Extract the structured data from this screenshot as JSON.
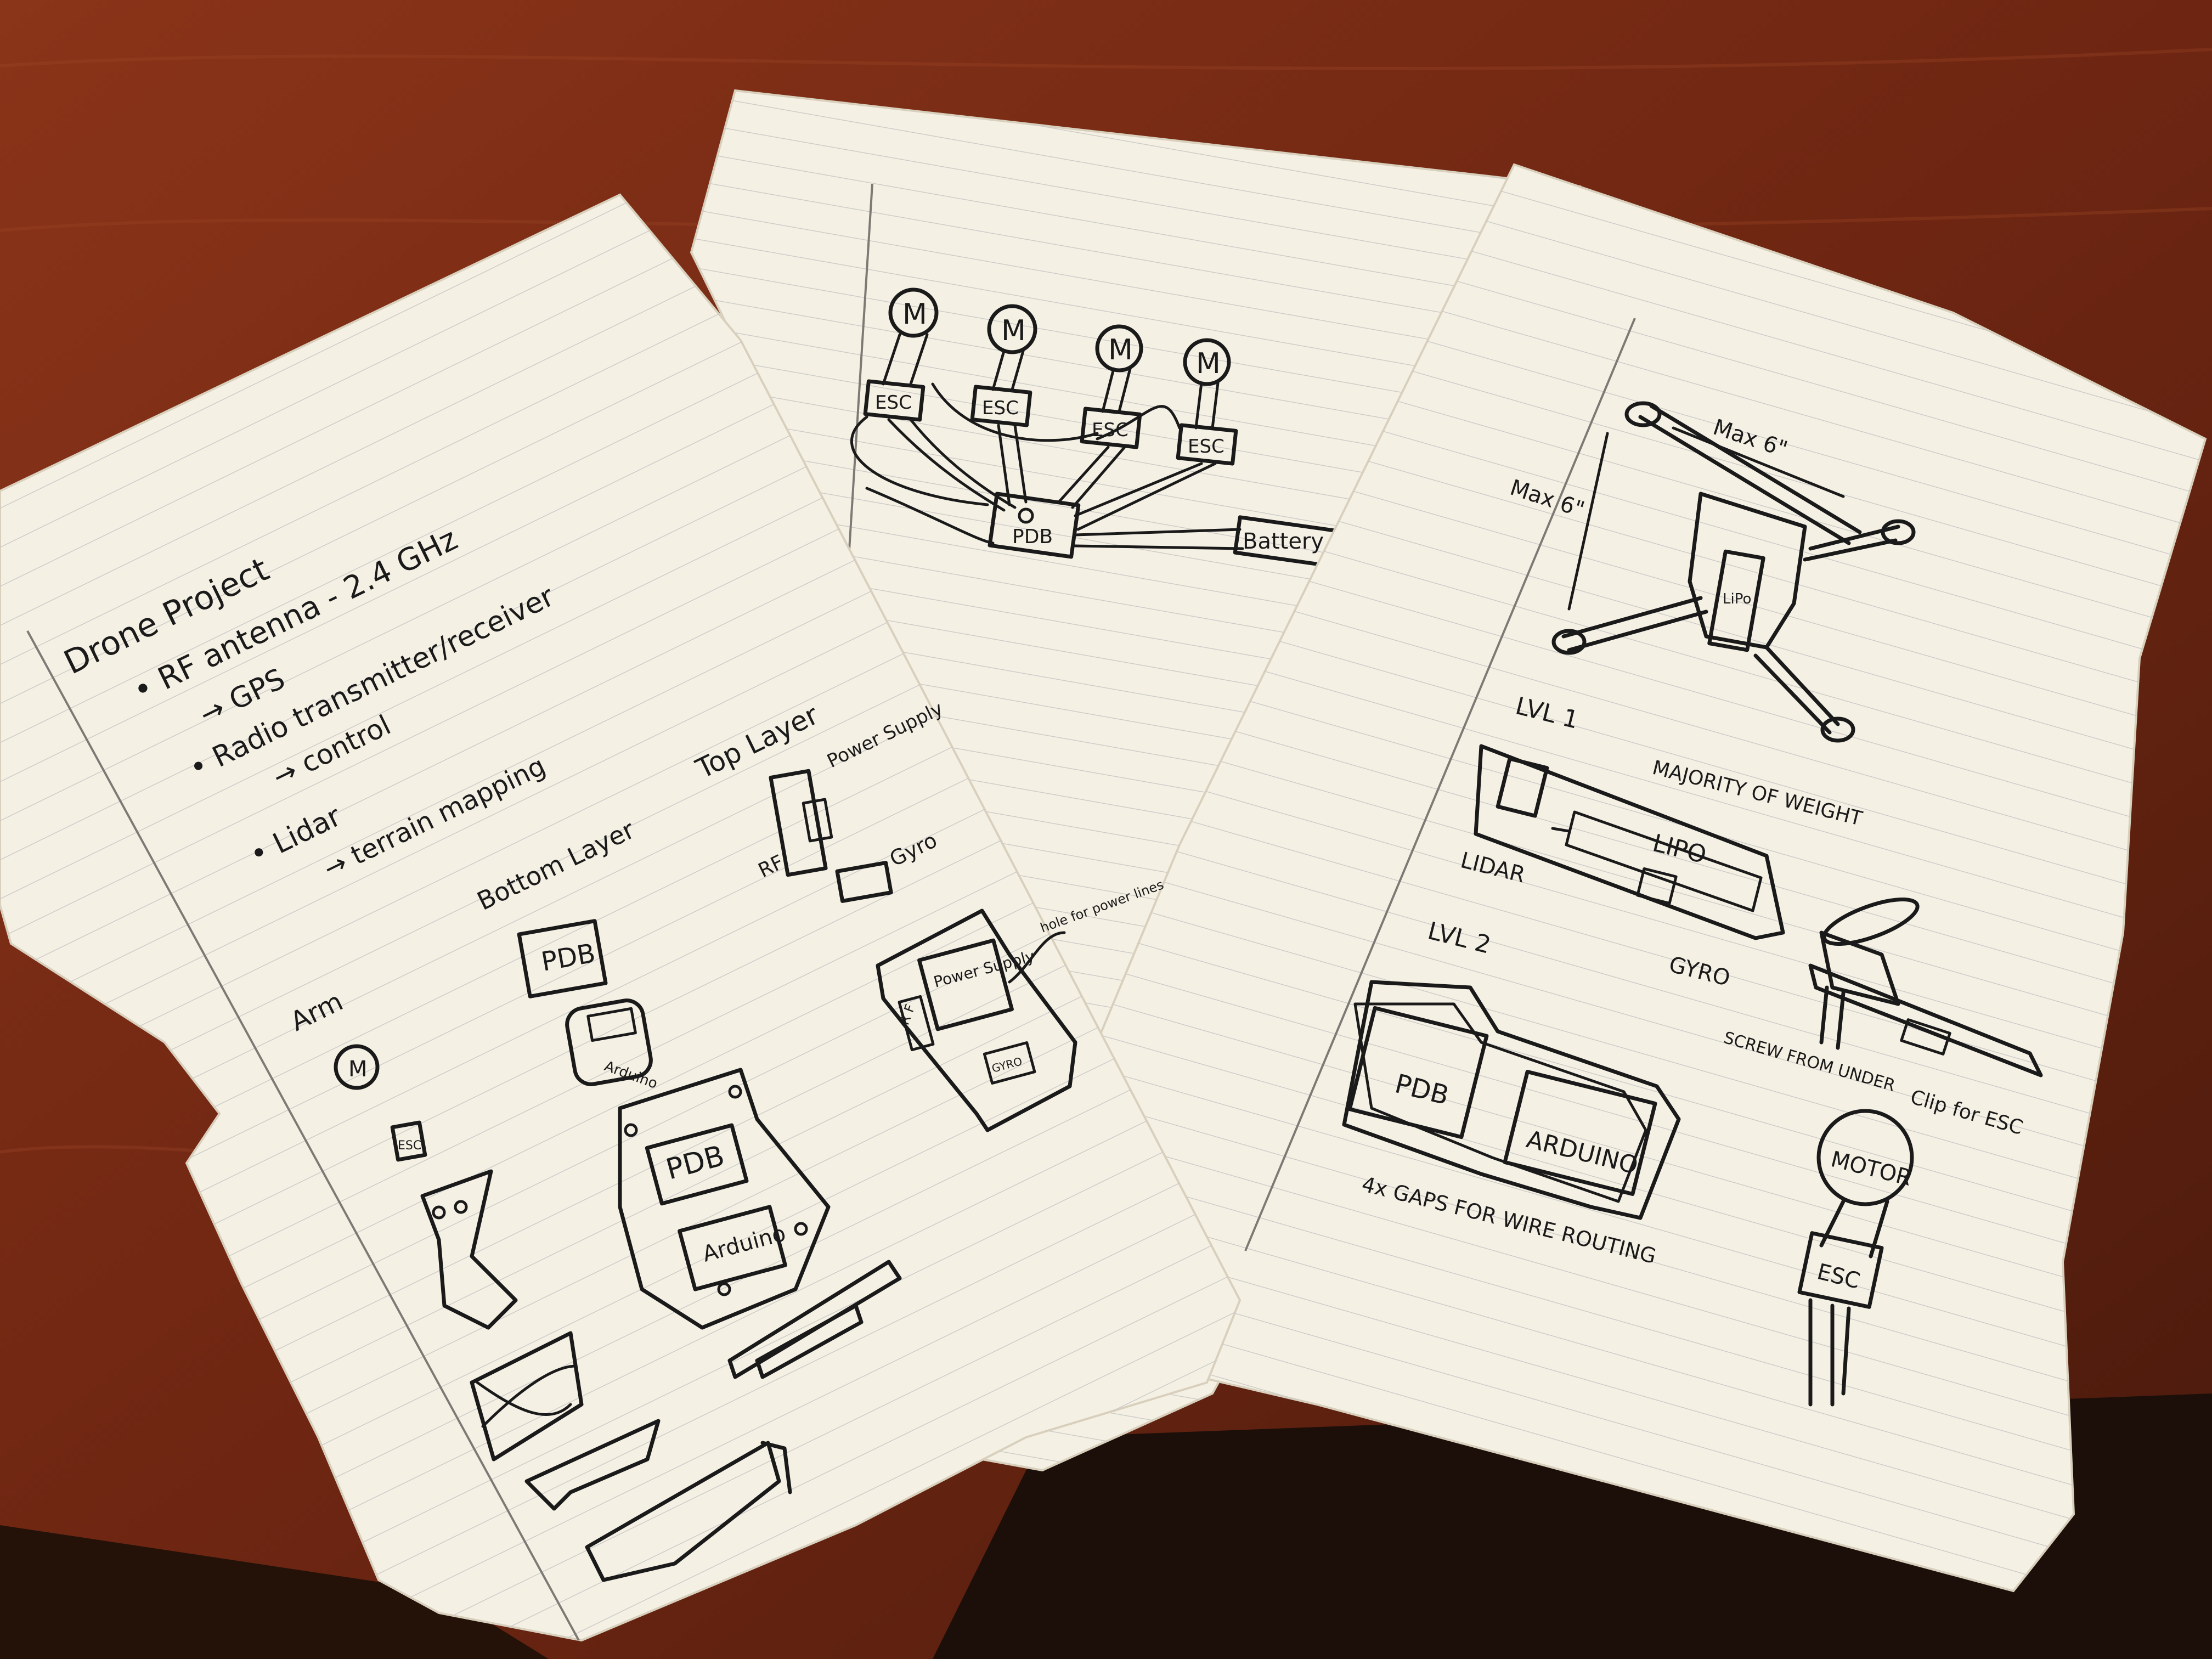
{
  "scene": {
    "colors": {
      "desk_wood": "#7a2c14",
      "desk_wood_light": "#9a4424",
      "desk_dark": "#1c0f0a",
      "paper": "#f5f0e4",
      "paper_shadow": "#d8d0bd",
      "rule_line": "#c9c8c6",
      "margin_line": "#7d7a76",
      "ink": "#1a1a1a"
    }
  },
  "left_sheet": {
    "title": "Drone Project",
    "notes": [
      "• RF antenna - 2.4 GHz",
      "→ GPS",
      "• Radio transmitter/receiver",
      "→ control",
      "• Lidar",
      "→ terrain mapping"
    ],
    "labels": {
      "top_layer": "Top Layer",
      "power_supply": "Power Supply",
      "rf": "RF",
      "gyro": "Gyro",
      "bottom_layer": "Bottom Layer",
      "pdb": "PDB",
      "arduino": "Arduino",
      "arm": "Arm",
      "motor": "M",
      "esc": "ESC",
      "hole_for_power_lines": "hole for power lines",
      "pdb_big": "PDB",
      "arduino_big": "Arduino",
      "power_supply_small": "Power Supply",
      "rf_small": "R F",
      "gyro_small": "GYRO"
    }
  },
  "middle_sheet": {
    "motor_labels": [
      "M",
      "M",
      "M",
      "M"
    ],
    "esc_labels": [
      "ESC",
      "ESC",
      "ESC",
      "ESC"
    ],
    "pdb": "PDB",
    "battery": "Battery"
  },
  "right_sheet": {
    "frame_width": "Max 6\"",
    "frame_height": "Max 6\"",
    "frame_center": "LiPo",
    "lvl1": "LVL 1",
    "majority_of_weight": "MAJORITY OF WEIGHT",
    "lipo": "LIPO",
    "lidar": "LIDAR",
    "gyro": "GYRO",
    "lvl2": "LVL 2",
    "pdb": "PDB",
    "arduino": "ARDUINO",
    "gaps_note": "4x GAPS FOR WIRE ROUTING",
    "screw_note": "SCREW FROM UNDER",
    "clip_note": "Clip for ESC",
    "motor": "MOTOR",
    "esc": "ESC"
  }
}
